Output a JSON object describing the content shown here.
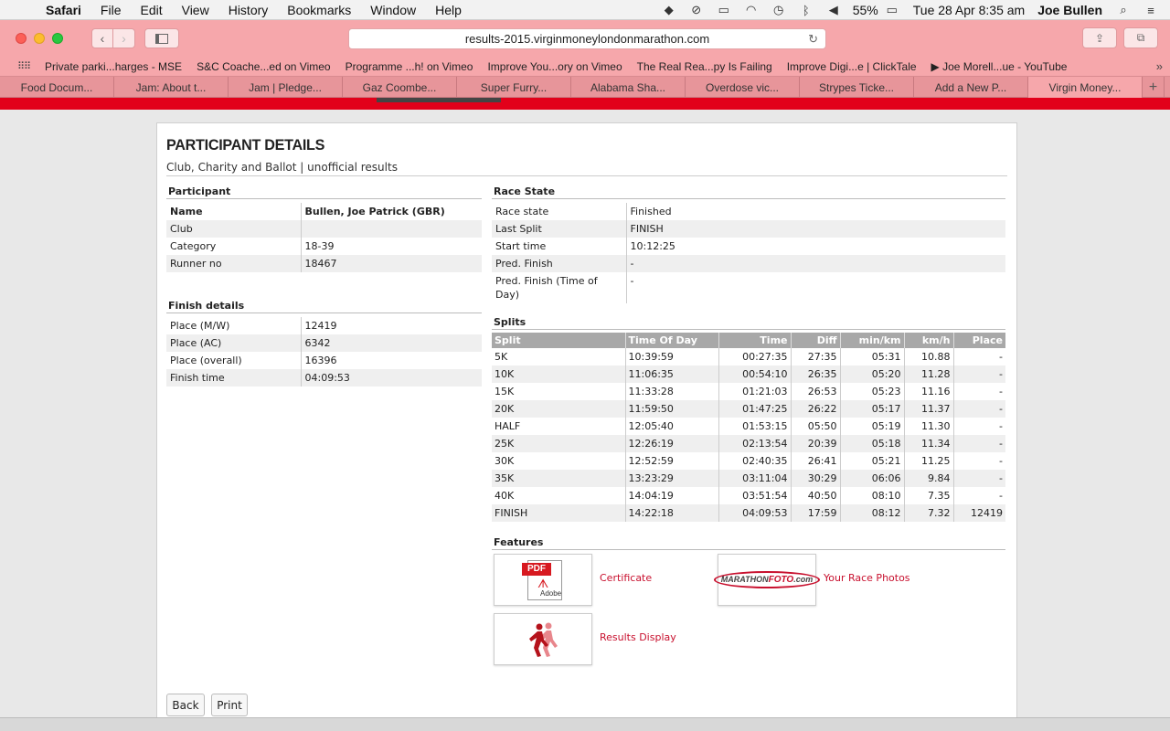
{
  "menubar": {
    "app": "Safari",
    "items": [
      "File",
      "Edit",
      "View",
      "History",
      "Bookmarks",
      "Window",
      "Help"
    ],
    "battery": "55%",
    "datetime": "Tue 28 Apr  8:35 am",
    "user": "Joe Bullen"
  },
  "browser": {
    "url": "results-2015.virginmoneylondonmarathon.com",
    "bookmarks": [
      "Private parki...harges - MSE",
      "S&C Coache...ed on Vimeo",
      "Programme ...h! on Vimeo",
      "Improve You...ory on Vimeo",
      "The Real Rea...py Is Failing",
      "Improve Digi...e | ClickTale",
      "▶ Joe Morell...ue - YouTube"
    ],
    "tabs": [
      "Food Docum...",
      "Jam: About t...",
      "Jam | Pledge...",
      "Gaz Coombe...",
      "Super Furry...",
      "Alabama Sha...",
      "Overdose vic...",
      "Strypes Ticke...",
      "Add a New P...",
      "Virgin Money..."
    ],
    "active_tab_index": 9
  },
  "page": {
    "title": "PARTICIPANT DETAILS",
    "subtitle": "Club, Charity and Ballot | unofficial results",
    "participant": {
      "heading": "Participant",
      "rows": [
        {
          "k": "Name",
          "v": "Bullen, Joe Patrick (GBR)"
        },
        {
          "k": "Club",
          "v": ""
        },
        {
          "k": "Category",
          "v": "18-39"
        },
        {
          "k": "Runner no",
          "v": "18467"
        }
      ]
    },
    "finish": {
      "heading": "Finish details",
      "rows": [
        {
          "k": "Place (M/W)",
          "v": "12419"
        },
        {
          "k": "Place (AC)",
          "v": "6342"
        },
        {
          "k": "Place (overall)",
          "v": "16396"
        },
        {
          "k": "Finish time",
          "v": "04:09:53"
        }
      ]
    },
    "race_state": {
      "heading": "Race State",
      "rows": [
        {
          "k": "Race state",
          "v": "Finished"
        },
        {
          "k": "Last Split",
          "v": "FINISH"
        },
        {
          "k": "Start time",
          "v": "10:12:25"
        },
        {
          "k": "Pred. Finish",
          "v": "-"
        },
        {
          "k": "Pred. Finish (Time of Day)",
          "v": "-"
        }
      ]
    },
    "splits": {
      "heading": "Splits",
      "columns": [
        "Split",
        "Time Of Day",
        "Time",
        "Diff",
        "min/km",
        "km/h",
        "Place"
      ],
      "rows": [
        [
          "5K",
          "10:39:59",
          "00:27:35",
          "27:35",
          "05:31",
          "10.88",
          "-"
        ],
        [
          "10K",
          "11:06:35",
          "00:54:10",
          "26:35",
          "05:20",
          "11.28",
          "-"
        ],
        [
          "15K",
          "11:33:28",
          "01:21:03",
          "26:53",
          "05:23",
          "11.16",
          "-"
        ],
        [
          "20K",
          "11:59:50",
          "01:47:25",
          "26:22",
          "05:17",
          "11.37",
          "-"
        ],
        [
          "HALF",
          "12:05:40",
          "01:53:15",
          "05:50",
          "05:19",
          "11.30",
          "-"
        ],
        [
          "25K",
          "12:26:19",
          "02:13:54",
          "20:39",
          "05:18",
          "11.34",
          "-"
        ],
        [
          "30K",
          "12:52:59",
          "02:40:35",
          "26:41",
          "05:21",
          "11.25",
          "-"
        ],
        [
          "35K",
          "13:23:29",
          "03:11:04",
          "30:29",
          "06:06",
          "9.84",
          "-"
        ],
        [
          "40K",
          "14:04:19",
          "03:51:54",
          "40:50",
          "08:10",
          "7.35",
          "-"
        ],
        [
          "FINISH",
          "14:22:18",
          "04:09:53",
          "17:59",
          "08:12",
          "7.32",
          "12419"
        ]
      ]
    },
    "features": {
      "heading": "Features",
      "certificate": "Certificate",
      "photos": "Your Race Photos",
      "results_display": "Results Display",
      "pdf_tag": "PDF",
      "adobe": "Adobe",
      "marathonfoto_a": "MARATHON",
      "marathonfoto_b": "FOTO",
      "marathonfoto_c": ".com"
    },
    "buttons": {
      "back": "Back",
      "print": "Print"
    }
  },
  "colors": {
    "brand_red": "#e2001a",
    "link_red": "#c8102e",
    "chrome_pink": "#f6a7ab"
  }
}
